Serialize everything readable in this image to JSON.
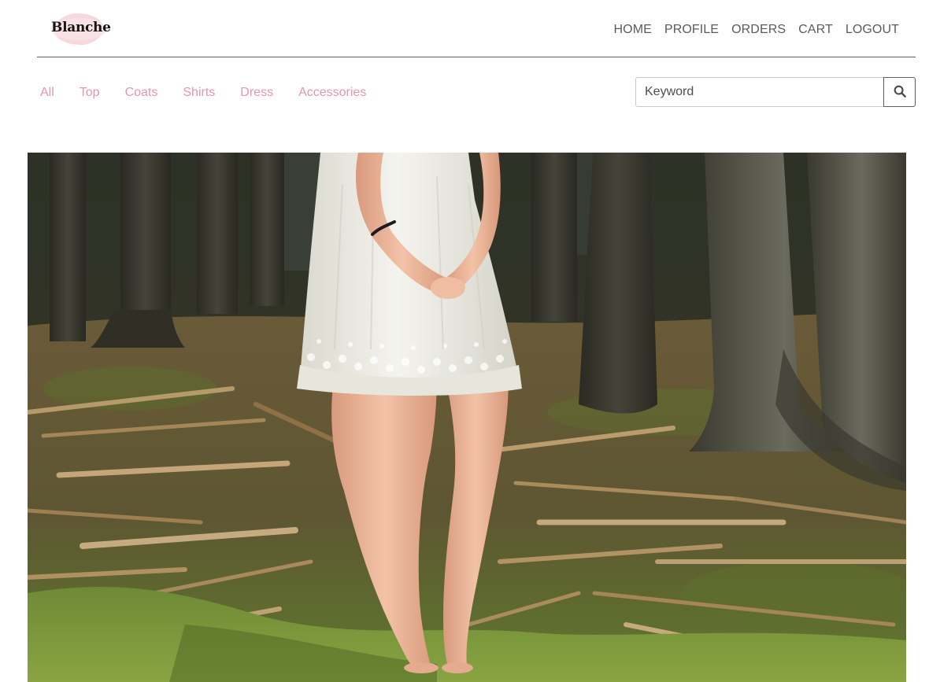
{
  "brand": {
    "name": "Blanche"
  },
  "nav": {
    "items": [
      {
        "label": "HOME",
        "name": "nav-home-link"
      },
      {
        "label": "PROFILE",
        "name": "nav-profile-link"
      },
      {
        "label": "ORDERS",
        "name": "nav-orders-link"
      },
      {
        "label": "CART",
        "name": "nav-cart-link"
      },
      {
        "label": "LOGOUT",
        "name": "nav-logout-link"
      }
    ]
  },
  "categories": {
    "items": [
      {
        "label": "All",
        "name": "category-all-link"
      },
      {
        "label": "Top",
        "name": "category-top-link"
      },
      {
        "label": "Coats",
        "name": "category-coats-link"
      },
      {
        "label": "Shirts",
        "name": "category-shirts-link"
      },
      {
        "label": "Dress",
        "name": "category-dress-link"
      },
      {
        "label": "Accessories",
        "name": "category-accessories-link"
      }
    ]
  },
  "search": {
    "placeholder": "Keyword",
    "value": "",
    "button_icon": "search-icon"
  },
  "hero": {
    "image_alt": "Woman in white lace dress standing barefoot in a forest clearing"
  },
  "colors": {
    "nav_text": "#5a5a5a",
    "category_text": "#e695ae",
    "divider": "#5b5b5b",
    "logo_blob": "#f7d9dd"
  }
}
